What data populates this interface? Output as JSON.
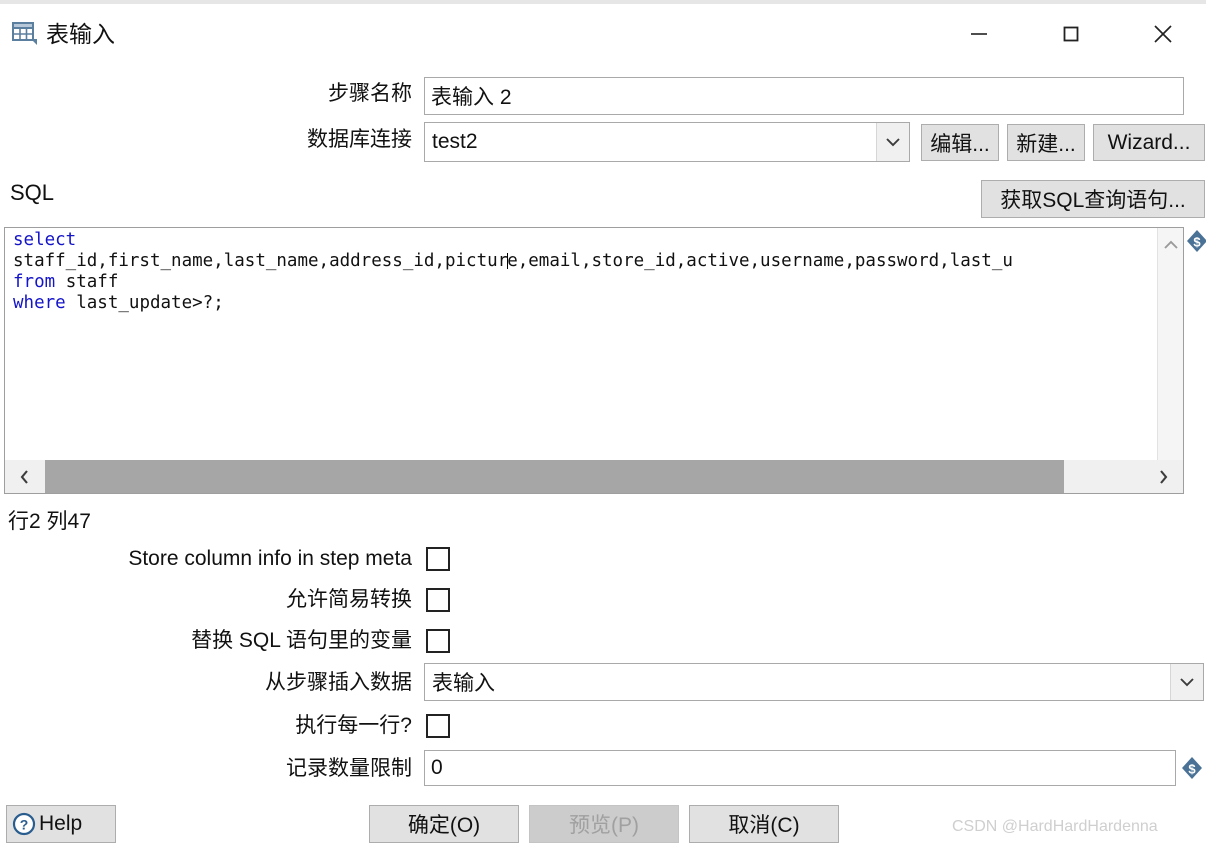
{
  "window": {
    "title": "表输入",
    "icon": "table-input-icon",
    "minimize_label": "—",
    "maximize_label": "□",
    "close_label": "✕"
  },
  "form": {
    "step_name_label": "步骤名称",
    "step_name_value": "表输入 2",
    "connection_label": "数据库连接",
    "connection_value": "test2",
    "edit_button": "编辑...",
    "new_button": "新建...",
    "wizard_button": "Wizard..."
  },
  "sql": {
    "section_label": "SQL",
    "get_sql_button": "获取SQL查询语句...",
    "lines": [
      {
        "keyword": "select",
        "rest": ""
      },
      {
        "keyword": "",
        "rest": "staff_id,first_name,last_name,address_id,pictur|e,email,store_id,active,username,password,last_u"
      },
      {
        "keyword": "from",
        "rest": " staff"
      },
      {
        "keyword": "where",
        "rest": " last_update>?;"
      }
    ],
    "full_text": "select\nstaff_id,first_name,last_name,address_id,picture,email,store_id,active,username,password,last_u\nfrom staff\nwhere last_update>?;",
    "caret_after": "pictur",
    "position_status": "行2 列47",
    "variable_icon": "dollar-diamond-icon"
  },
  "options": {
    "store_column_info_label": "Store column info in step meta",
    "store_column_info_checked": false,
    "lazy_conversion_label": "允许简易转换",
    "lazy_conversion_checked": false,
    "replace_variables_label": "替换 SQL 语句里的变量",
    "replace_variables_checked": false,
    "insert_data_from_step_label": "从步骤插入数据",
    "insert_data_from_step_value": "表输入",
    "execute_for_each_row_label": "执行每一行?",
    "execute_for_each_row_checked": false,
    "limit_label": "记录数量限制",
    "limit_value": "0",
    "limit_variable_icon": "dollar-diamond-icon"
  },
  "footer": {
    "help_label": "Help",
    "help_icon": "question-circle-icon",
    "ok_label": "确定(O)",
    "preview_label": "预览(P)",
    "preview_disabled": true,
    "cancel_label": "取消(C)",
    "watermark": "CSDN @HardHardHardenna"
  },
  "colors": {
    "keyword_blue": "#1414c8",
    "button_face": "#e1e1e1",
    "disabled_text": "#a0a0a0",
    "scroll_thumb": "#a6a6a6",
    "accent_icon": "#4a7296"
  }
}
